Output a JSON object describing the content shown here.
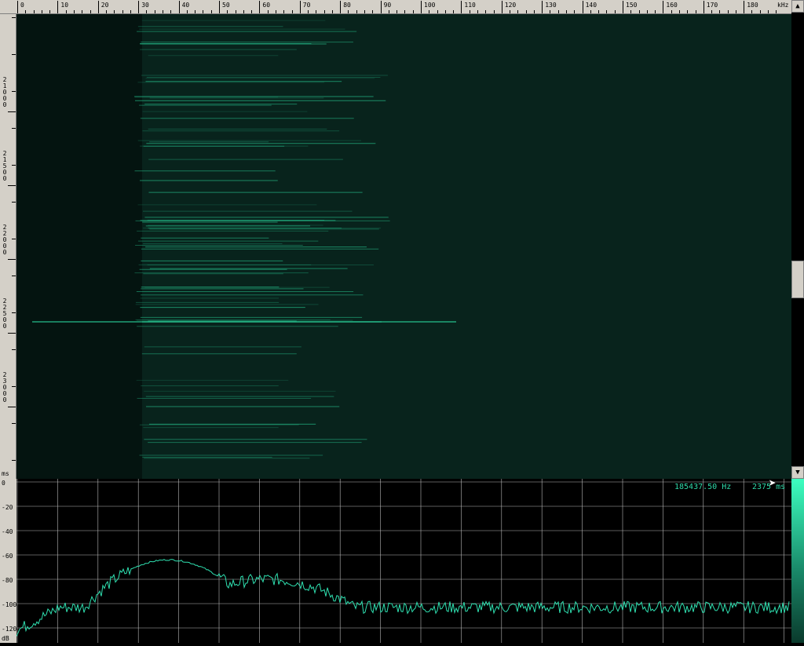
{
  "freq_axis": {
    "ticks": [
      "0",
      "10",
      "20",
      "30",
      "40",
      "50",
      "60",
      "70",
      "80",
      "90",
      "100",
      "110",
      "120",
      "130",
      "140",
      "150",
      "160",
      "170",
      "180"
    ],
    "unit": "kHz"
  },
  "time_axis": {
    "ticks": [
      "21000",
      "21500",
      "22000",
      "22500",
      "23000"
    ],
    "unit": "ms"
  },
  "spectrum": {
    "db_ticks": [
      "0",
      "-20",
      "-40",
      "-60",
      "-80",
      "-100",
      "-120"
    ],
    "db_unit": "dB",
    "readout_freq": "185437.50 Hz",
    "readout_time": "2375 ms",
    "x_min_khz": 0,
    "x_max_khz": 192,
    "y_min_db": -130,
    "y_max_db": 0
  },
  "colors": {
    "trace": "#2fe0b0",
    "grid": "#b8b8b8",
    "spectrogram_bg": "#08231c",
    "harmonic": "#2ad69c"
  },
  "icons": {
    "scroll_up": "triangle-up-icon",
    "scroll_down": "triangle-down-icon",
    "mouse_cursor": "arrow-cursor-icon"
  }
}
